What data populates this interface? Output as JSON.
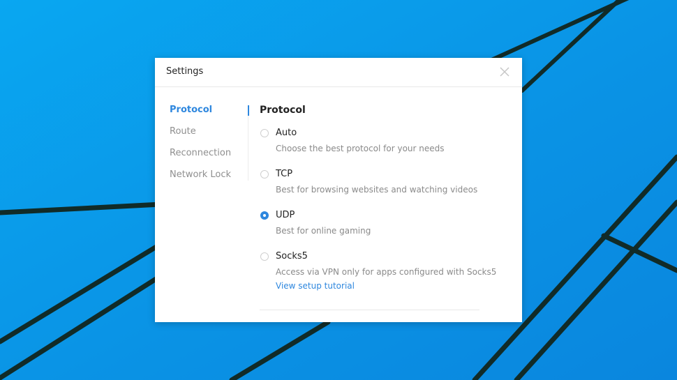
{
  "window": {
    "title": "Settings"
  },
  "sidebar": {
    "items": [
      {
        "label": "Protocol",
        "active": true
      },
      {
        "label": "Route",
        "active": false
      },
      {
        "label": "Reconnection",
        "active": false
      },
      {
        "label": "Network Lock",
        "active": false
      }
    ]
  },
  "content": {
    "title": "Protocol",
    "options": [
      {
        "label": "Auto",
        "description": "Choose the best protocol for your needs",
        "selected": false
      },
      {
        "label": "TCP",
        "description": "Best for browsing websites and watching videos",
        "selected": false
      },
      {
        "label": "UDP",
        "description": "Best for online gaming",
        "selected": true
      },
      {
        "label": "Socks5",
        "description": "Access via VPN only for apps configured with Socks5",
        "link": "View setup tutorial",
        "selected": false
      }
    ]
  },
  "colors": {
    "accent": "#2e87de",
    "wallpaper": "#0aa0ea",
    "text": "#222222",
    "muted": "#8a8a8a"
  },
  "icons": {
    "close": "close-icon",
    "radio": "radio-button-icon"
  }
}
